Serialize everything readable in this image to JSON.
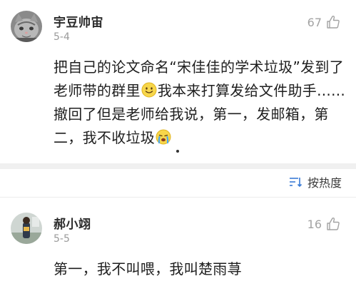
{
  "comments": [
    {
      "username": "宇豆帅宙",
      "date": "5-4",
      "likes": "67",
      "text_parts": [
        "把自己的论文命名“宋佳佳的学术垃圾”发到了老师带的群里",
        "我本来打算发给文件助手......撤回了但是老师给我说，第一，发邮箱，第二，我不收垃圾"
      ],
      "emojis": [
        "smile-emoji",
        "crying-emoji"
      ]
    },
    {
      "username": "郝小翊",
      "date": "5-5",
      "likes": "16",
      "text": "第一，我不叫喂，我叫楚雨荨"
    }
  ],
  "sort": {
    "label": "按热度"
  }
}
